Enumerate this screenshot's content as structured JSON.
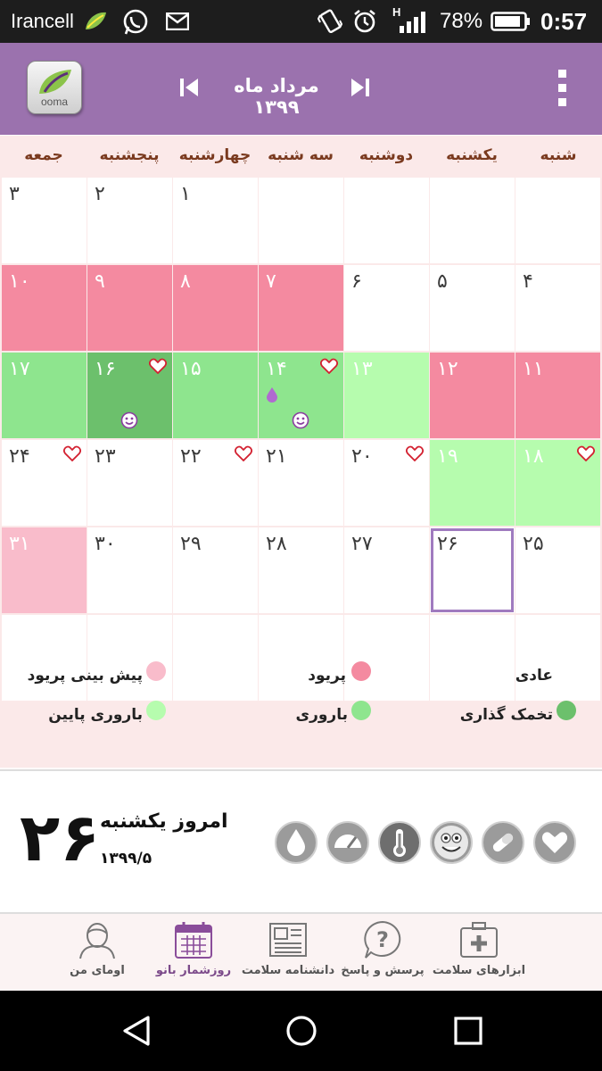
{
  "status_bar": {
    "carrier": "Irancell",
    "battery_percent": "78%",
    "time": "0:57",
    "network": "H",
    "icons": [
      "leaf-app-icon",
      "whatsapp-icon",
      "mail-icon",
      "vibrate-icon",
      "alarm-icon",
      "signal-icon",
      "battery-icon"
    ]
  },
  "header": {
    "logo_text": "ooma",
    "month_title": "مرداد ماه ۱۳۹۹",
    "accent_color": "#9b72ae"
  },
  "weekdays": [
    "شنبه",
    "یکشنبه",
    "دوشنبه",
    "سه شنبه",
    "چهارشنبه",
    "پنجشنبه",
    "جمعه"
  ],
  "calendar": {
    "today": "۲۶",
    "days": [
      {
        "n": "۱"
      },
      {
        "n": "۲"
      },
      {
        "n": "۳"
      },
      {
        "n": "۴"
      },
      {
        "n": "۵"
      },
      {
        "n": "۶"
      },
      {
        "n": "۷",
        "status": "period"
      },
      {
        "n": "۸",
        "status": "period"
      },
      {
        "n": "۹",
        "status": "period"
      },
      {
        "n": "۱۰",
        "status": "period"
      },
      {
        "n": "۱۱",
        "status": "period"
      },
      {
        "n": "۱۲",
        "status": "period"
      },
      {
        "n": "۱۳",
        "status": "fertility-light"
      },
      {
        "n": "۱۴",
        "status": "fertility",
        "heart": true,
        "drop": true,
        "smile": true
      },
      {
        "n": "۱۵",
        "status": "fertility"
      },
      {
        "n": "۱۶",
        "status": "ovulation",
        "heart": true,
        "smile": true
      },
      {
        "n": "۱۷",
        "status": "fertility"
      },
      {
        "n": "۱۸",
        "status": "fertility-light",
        "heart": true
      },
      {
        "n": "۱۹",
        "status": "fertility-light"
      },
      {
        "n": "۲۰",
        "heart": true
      },
      {
        "n": "۲۱"
      },
      {
        "n": "۲۲",
        "heart": true
      },
      {
        "n": "۲۳"
      },
      {
        "n": "۲۴",
        "heart": true
      },
      {
        "n": "۲۵"
      },
      {
        "n": "۲۶",
        "today": true
      },
      {
        "n": "۲۷"
      },
      {
        "n": "۲۸"
      },
      {
        "n": "۲۹"
      },
      {
        "n": "۳۰"
      },
      {
        "n": "۳۱",
        "status": "predicted-period"
      }
    ]
  },
  "legend": {
    "normal": "عادی",
    "period": "پریود",
    "predicted_period": "پیش بینی پریود",
    "ovulation": "تخمک گذاری",
    "fertility": "باروری",
    "low_fertility": "باروری پایین",
    "colors": {
      "period": "#f48aa0",
      "predicted_period": "#f9bccb",
      "ovulation": "#6cc06c",
      "fertility": "#8ee58e",
      "low_fertility": "#b6fcae"
    }
  },
  "today_panel": {
    "day_number": "۲۶",
    "label": "امروز یکشنبه",
    "date": "۱۳۹۹/۵",
    "tools": [
      "heart-icon",
      "pill-icon",
      "mood-face-icon",
      "thermometer-icon",
      "gauge-icon",
      "drop-icon"
    ]
  },
  "bottom_nav": {
    "items": [
      {
        "label": "ابزارهای سلامت",
        "icon": "medical-kit-icon"
      },
      {
        "label": "پرسش و پاسخ",
        "icon": "question-bubble-icon"
      },
      {
        "label": "دانشنامه سلامت",
        "icon": "newspaper-icon"
      },
      {
        "label": "روزشمار بانو",
        "icon": "calendar-icon",
        "active": true
      },
      {
        "label": "اومای من",
        "icon": "profile-icon"
      }
    ]
  }
}
